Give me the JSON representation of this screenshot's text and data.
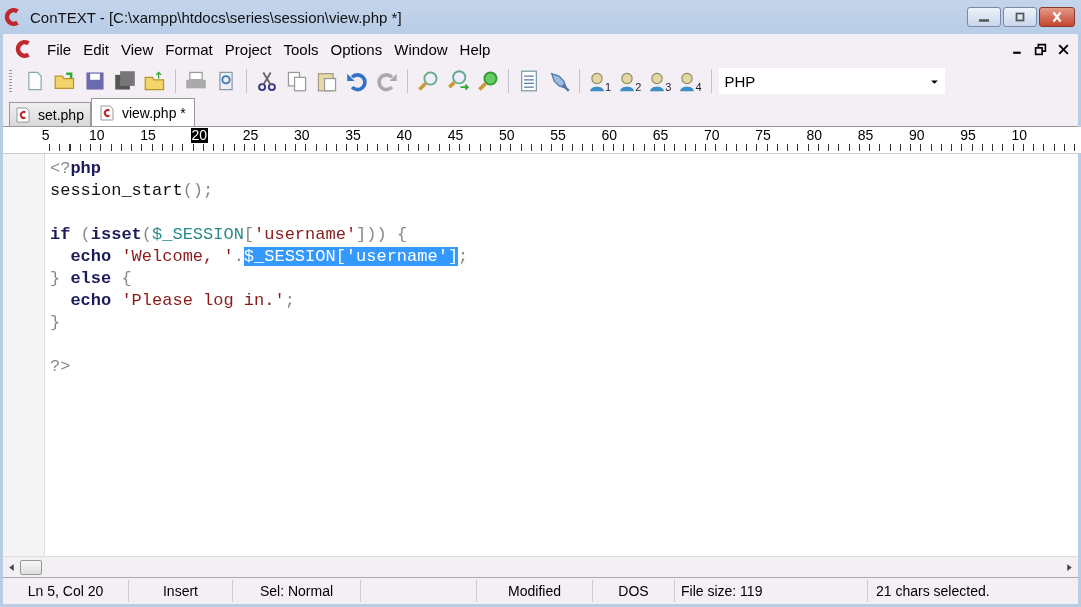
{
  "window": {
    "title": "ConTEXT - [C:\\xampp\\htdocs\\series\\session\\view.php *]"
  },
  "menu": [
    "File",
    "Edit",
    "View",
    "Format",
    "Project",
    "Tools",
    "Options",
    "Window",
    "Help"
  ],
  "toolbar": {
    "user_buttons": [
      "1",
      "2",
      "3",
      "4"
    ],
    "highlighter": {
      "value": "PHP"
    }
  },
  "tabs": [
    {
      "label": "set.php",
      "selected": false
    },
    {
      "label": "view.php *",
      "selected": true
    }
  ],
  "ruler": [
    {
      "text": "5",
      "selected": false
    },
    {
      "text": "10",
      "selected": false
    },
    {
      "text": "15",
      "selected": false
    },
    {
      "text": "20",
      "selected": true
    },
    {
      "text": "25",
      "selected": false
    },
    {
      "text": "30",
      "selected": false
    },
    {
      "text": "35",
      "selected": false
    },
    {
      "text": "40",
      "selected": false
    },
    {
      "text": "45",
      "selected": false
    },
    {
      "text": "50",
      "selected": false
    },
    {
      "text": "55",
      "selected": false
    },
    {
      "text": "60",
      "selected": false
    },
    {
      "text": "65",
      "selected": false
    },
    {
      "text": "70",
      "selected": false
    },
    {
      "text": "75",
      "selected": false
    },
    {
      "text": "80",
      "selected": false
    },
    {
      "text": "85",
      "selected": false
    },
    {
      "text": "90",
      "selected": false
    },
    {
      "text": "95",
      "selected": false
    },
    {
      "text": "10",
      "selected": false
    }
  ],
  "code": [
    {
      "kind": "code",
      "tokens": [
        {
          "kind": "punct",
          "text": "<?"
        },
        {
          "kind": "keyword",
          "text": "php"
        }
      ]
    },
    {
      "kind": "code",
      "tokens": [
        {
          "kind": "plain",
          "text": "session_start"
        },
        {
          "kind": "punct",
          "text": "();"
        }
      ]
    },
    {
      "kind": "blank"
    },
    {
      "kind": "code",
      "tokens": [
        {
          "kind": "keyword",
          "text": "if"
        },
        {
          "kind": "punct",
          "text": " ("
        },
        {
          "kind": "keyword",
          "text": "isset"
        },
        {
          "kind": "punct",
          "text": "("
        },
        {
          "kind": "variable",
          "text": "$_SESSION"
        },
        {
          "kind": "punct",
          "text": "["
        },
        {
          "kind": "string",
          "text": "'username'"
        },
        {
          "kind": "punct",
          "text": "])) {"
        }
      ]
    },
    {
      "kind": "code",
      "tokens": [
        {
          "kind": "keyword",
          "text": "  echo"
        },
        {
          "kind": "string",
          "text": " 'Welcome, '"
        },
        {
          "kind": "punct",
          "text": "."
        },
        {
          "kind": "selected",
          "text": "$_SESSION['username']"
        },
        {
          "kind": "punct",
          "text": ";"
        }
      ]
    },
    {
      "kind": "code",
      "tokens": [
        {
          "kind": "punct",
          "text": "} "
        },
        {
          "kind": "keyword",
          "text": "else"
        },
        {
          "kind": "punct",
          "text": " {"
        }
      ]
    },
    {
      "kind": "code",
      "tokens": [
        {
          "kind": "keyword",
          "text": "  echo"
        },
        {
          "kind": "string",
          "text": " 'Please log in.'"
        },
        {
          "kind": "punct",
          "text": ";"
        }
      ]
    },
    {
      "kind": "code",
      "tokens": [
        {
          "kind": "punct",
          "text": "}"
        }
      ]
    },
    {
      "kind": "blank"
    },
    {
      "kind": "code",
      "tokens": [
        {
          "kind": "punct",
          "text": "?>"
        }
      ]
    }
  ],
  "status_bar": [
    "Ln 5, Col 20",
    "Insert",
    "Sel: Normal",
    "Modified",
    "DOS",
    "File size: 119",
    "21 chars selected."
  ]
}
